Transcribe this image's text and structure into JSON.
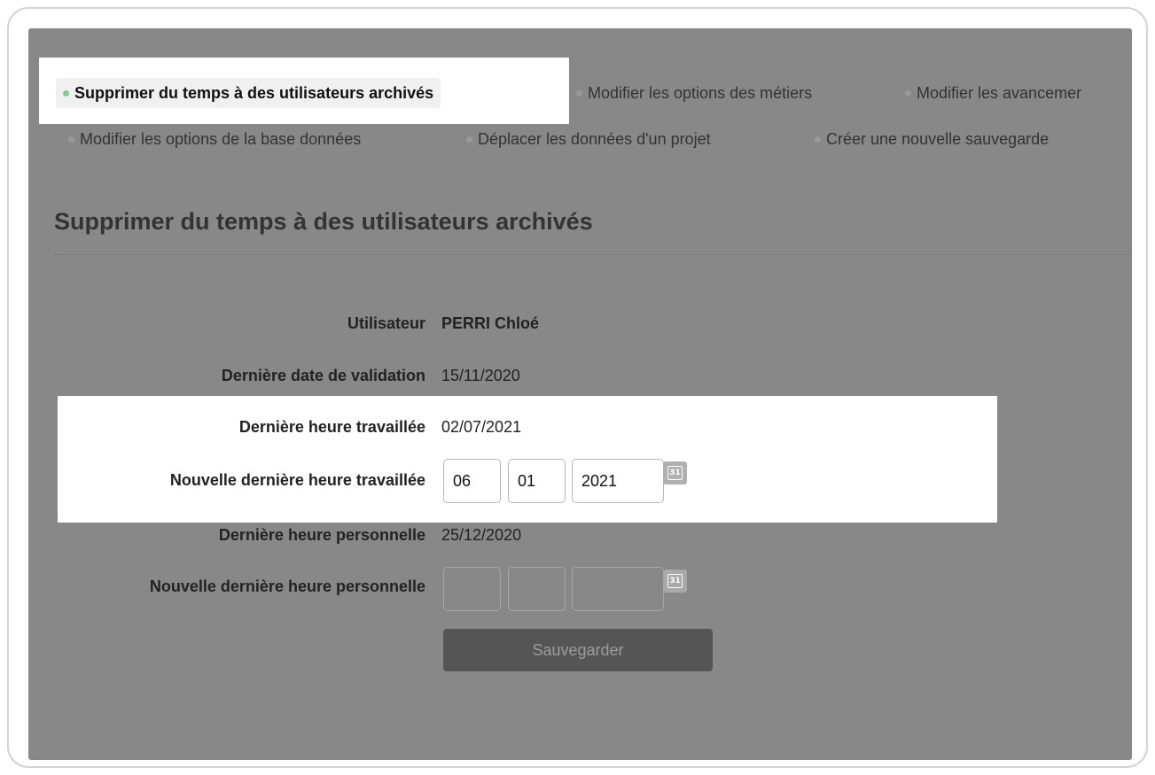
{
  "tabs": [
    {
      "label": "Supprimer du temps à des utilisateurs archivés",
      "active": true
    },
    {
      "label": "Modifier les options des métiers"
    },
    {
      "label": "Modifier les avancemer"
    },
    {
      "label": "Modifier les options de la base données"
    },
    {
      "label": "Déplacer les données d'un projet"
    },
    {
      "label": "Créer une nouvelle sauvegarde"
    }
  ],
  "page_title": "Supprimer du temps à des utilisateurs archivés",
  "form": {
    "user_label": "Utilisateur",
    "user_value": "PERRI Chloé",
    "last_validation_label": "Dernière date de validation",
    "last_validation_value": "15/11/2020",
    "last_worked_label": "Dernière heure travaillée",
    "last_worked_value": "02/07/2021",
    "new_last_worked_label": "Nouvelle dernière heure travaillée",
    "new_last_worked": {
      "day": "06",
      "month": "01",
      "year": "2021"
    },
    "last_personal_label": "Dernière heure personnelle",
    "last_personal_value": "25/12/2020",
    "new_last_personal_label": "Nouvelle dernière heure personnelle",
    "new_last_personal": {
      "day": "",
      "month": "",
      "year": ""
    },
    "calendar_icon_text": "31",
    "save_label": "Sauvegarder"
  },
  "colors": {
    "overlay": "#888888",
    "active_dot": "#7fcf8a",
    "button": "#555555"
  },
  "icons": [
    "calendar-icon"
  ]
}
